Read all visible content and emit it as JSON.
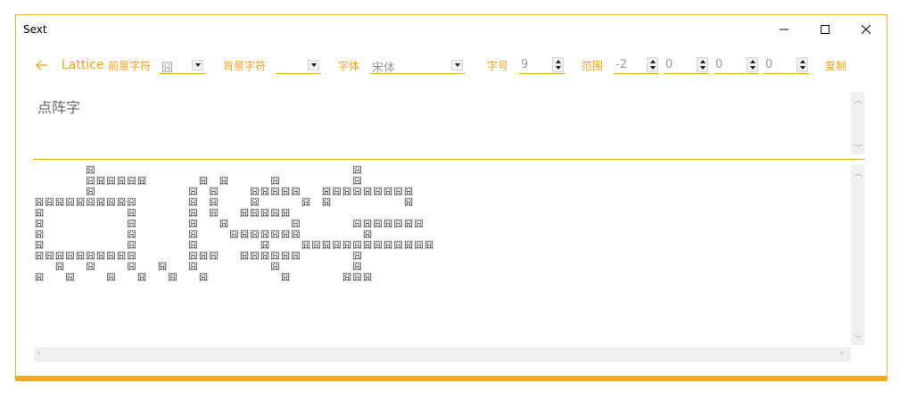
{
  "window": {
    "title": "Sext"
  },
  "toolbar": {
    "back_icon": "arrow-left-icon",
    "app_name": "Lattice",
    "foreground_label": "前景字符",
    "foreground_value": "囧",
    "background_label": "背景字符",
    "background_value": "",
    "font_label": "字体",
    "font_value": "宋体",
    "size_label": "字号",
    "size_value": "9",
    "range_label": "范围",
    "range_values": [
      "-2",
      "0",
      "0",
      "0"
    ],
    "copy_label": "复制"
  },
  "input": {
    "text": "点阵字"
  },
  "output": {
    "glyph": "囧",
    "rows": [
      "     #                         #         ",
      "     ######     # #    #       #         ",
      "     #         # #   #####  #########   ",
      "##########     # #   #    # #       #   ",
      "#        #     # #  #####         ",
      "#        #     #  #      #     #######   ",
      "#        #     #   #######      #        ",
      "#        #     #      #   #############  ",
      "##########     ###  ######     #         ",
      "  #  #   #  #  #       #       #         ",
      "#  #   #  #  #  #       #     ###        "
    ]
  },
  "colors": {
    "accent": "#f0a020",
    "border": "#f3b23a",
    "bottom_bar": "#f5a623"
  }
}
